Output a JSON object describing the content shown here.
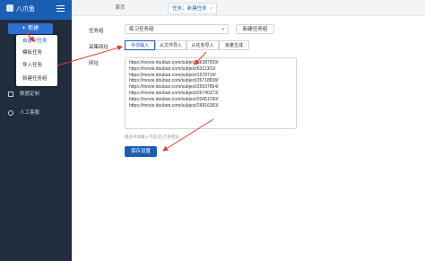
{
  "sidebar": {
    "logo_text": "八爪鱼",
    "new_button_label": "新建",
    "dropdown": [
      "自定义任务",
      "模板任务",
      "导入任务",
      "新建任务组"
    ],
    "nav_items": [
      "数据定制",
      "人工客服"
    ]
  },
  "topbar": {
    "tabs": [
      {
        "label": "首页"
      },
      {
        "label": "任务：新建任务",
        "close": "×"
      }
    ]
  },
  "form": {
    "group_label": "任务组",
    "group_value": "练习任务组",
    "new_group_label": "新建任务组",
    "method_label": "采集网址",
    "methods": [
      "手动输入",
      "从文件导入",
      "从任务导入",
      "批量生成"
    ],
    "url_label": "网址",
    "urls": [
      "https://movie.douban.com/subject/26387939/",
      "https://movie.douban.com/subject/6311303/",
      "https://movie.douban.com/subject/1578714/",
      "https://movie.douban.com/subject/26718838/",
      "https://movie.douban.com/subject/25937854/",
      "https://movie.douban.com/subject/26740373/",
      "https://movie.douban.com/subject/20451290/",
      "https://movie.douban.com/subject/26816383/"
    ],
    "hint": "最多手动输入不超过1万条网址",
    "save_label": "保存设置"
  },
  "colors": {
    "sidebar_bg": "#1f2d3d",
    "brand": "#1a5fb4",
    "annotation_arrow": "#e8372c"
  }
}
